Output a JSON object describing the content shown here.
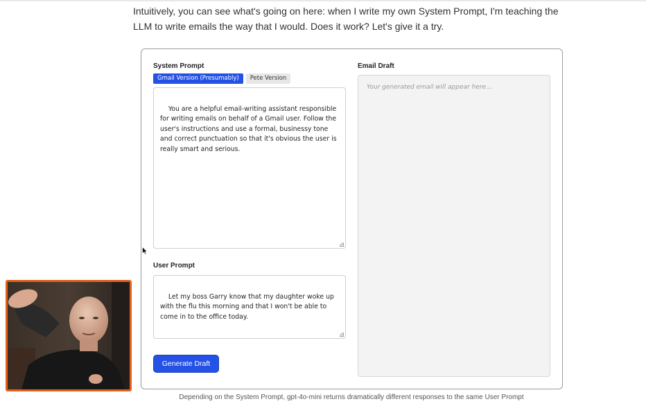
{
  "intro_text": "Intuitively, you can see what's going on here: when I write my own System Prompt, I'm teaching the LLM to write emails the way that I would. Does it work? Let's give it a try.",
  "demo": {
    "system_prompt_label": "System Prompt",
    "tabs": [
      {
        "label": "Gmail Version (Presumably)",
        "active": true
      },
      {
        "label": "Pete Version",
        "active": false
      }
    ],
    "system_prompt_value": "You are a helpful email-writing assistant responsible\nfor writing emails on behalf of a Gmail user. Follow the\nuser's instructions and use a formal, businessy tone\nand correct punctuation so that it's obvious the user is\nreally smart and serious.",
    "user_prompt_label": "User Prompt",
    "user_prompt_value": "Let my boss Garry know that my daughter woke up\nwith the flu this morning and that I won't be able to\ncome in to the office today.",
    "generate_label": "Generate Draft",
    "email_draft_label": "Email Draft",
    "email_draft_placeholder": "Your generated email will appear here..."
  },
  "caption": "Depending on the System Prompt, gpt-4o-mini returns dramatically different responses to the same User Prompt",
  "colors": {
    "accent": "#2452e6",
    "webcam_border": "#e0621c",
    "output_bg": "#f3f3f3"
  }
}
